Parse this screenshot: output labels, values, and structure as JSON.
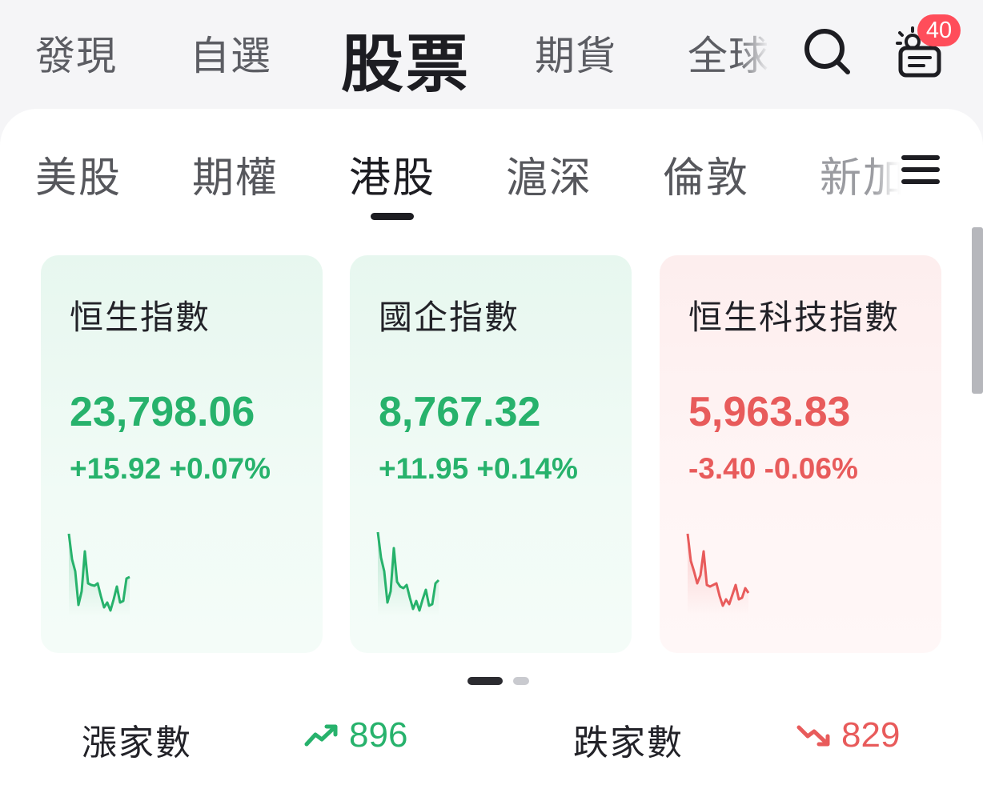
{
  "top_tabs": [
    {
      "label": "發現",
      "active": false
    },
    {
      "label": "自選",
      "active": false
    },
    {
      "label": "股票",
      "active": true
    },
    {
      "label": "期貨",
      "active": false
    },
    {
      "label": "全球",
      "active": false
    }
  ],
  "notifications": {
    "count": "40"
  },
  "market_tabs": [
    {
      "label": "美股",
      "active": false
    },
    {
      "label": "期權",
      "active": false
    },
    {
      "label": "港股",
      "active": true
    },
    {
      "label": "滬深",
      "active": false
    },
    {
      "label": "倫敦",
      "active": false
    },
    {
      "label": "新加",
      "active": false
    }
  ],
  "indices": [
    {
      "name": "恒生指數",
      "value": "23,798.06",
      "change": "+15.92 +0.07%",
      "direction": "up"
    },
    {
      "name": "國企指數",
      "value": "8,767.32",
      "change": "+11.95 +0.14%",
      "direction": "up"
    },
    {
      "name": "恒生科技指數",
      "value": "5,963.83",
      "change": "-3.40 -0.06%",
      "direction": "down"
    }
  ],
  "pager": {
    "current": 1,
    "total": 2
  },
  "breadth": {
    "advancers_label": "漲家數",
    "advancers": "896",
    "decliners_label": "跌家數",
    "decliners": "829"
  },
  "colors": {
    "up": "#27b26c",
    "down": "#e85b5b",
    "badge": "#ff4d5a",
    "text": "#1d1d22"
  },
  "icons": {
    "search": "search-icon",
    "notifications": "notification-bell-icon",
    "menu": "menu-icon",
    "up_trend": "trend-up-icon",
    "down_trend": "trend-down-icon"
  }
}
